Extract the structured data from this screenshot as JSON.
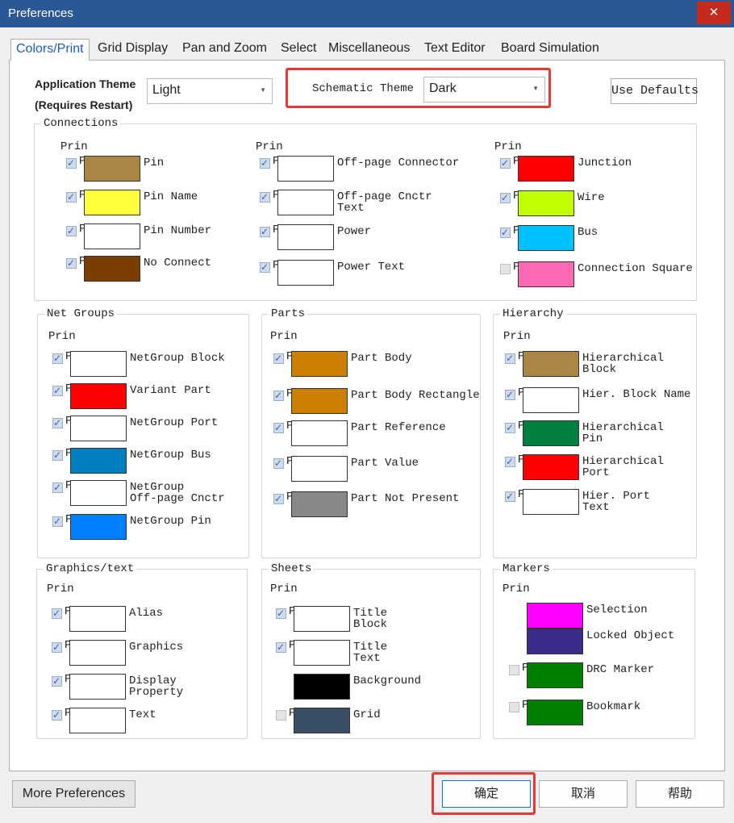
{
  "window": {
    "title": "Preferences",
    "close": "✕"
  },
  "tabs": [
    "Colors/Print",
    "Grid Display",
    "Pan and Zoom",
    "Select",
    "Miscellaneous",
    "Text Editor",
    "Board Simulation"
  ],
  "app_theme": {
    "label_line1": "Application Theme",
    "label_line2": "(Requires Restart)",
    "value": "Light"
  },
  "schematic_theme": {
    "label": "Schematic Theme",
    "value": "Dark"
  },
  "use_defaults": "Use Defaults",
  "print_header": "Prin",
  "check_cut": "P",
  "groups": {
    "connections": {
      "title": "Connections",
      "columns": [
        [
          {
            "label": [
              "Pin"
            ],
            "color": "#aa8544",
            "checked": true
          },
          {
            "label": [
              "Pin Name"
            ],
            "color": "#ffff3c",
            "checked": true
          },
          {
            "label": [
              "Pin Number"
            ],
            "color": "#ffffff",
            "checked": true
          },
          {
            "label": [
              "No Connect"
            ],
            "color": "#7b3d00",
            "checked": true
          }
        ],
        [
          {
            "label": [
              "Off-page Connector"
            ],
            "color": "#ffffff",
            "checked": true
          },
          {
            "label": [
              "Off-page Cnctr",
              "Text"
            ],
            "color": "#ffffff",
            "checked": true
          },
          {
            "label": [
              "Power"
            ],
            "color": "#ffffff",
            "checked": true
          },
          {
            "label": [
              "Power Text"
            ],
            "color": "#ffffff",
            "checked": true
          }
        ],
        [
          {
            "label": [
              "Junction"
            ],
            "color": "#ff0000",
            "checked": true
          },
          {
            "label": [
              "Wire"
            ],
            "color": "#bfff00",
            "checked": true
          },
          {
            "label": [
              "Bus"
            ],
            "color": "#00bfff",
            "checked": true
          },
          {
            "label": [
              "Connection Square"
            ],
            "color": "#ff69b4",
            "checked": false
          }
        ]
      ]
    },
    "net_groups": {
      "title": "Net Groups",
      "rows": [
        {
          "label": [
            "NetGroup Block"
          ],
          "color": "#ffffff",
          "checked": true
        },
        {
          "label": [
            "Variant Part"
          ],
          "color": "#ff0000",
          "checked": true
        },
        {
          "label": [
            "NetGroup Port"
          ],
          "color": "#ffffff",
          "checked": true
        },
        {
          "label": [
            "NetGroup Bus"
          ],
          "color": "#007fc0",
          "checked": true
        },
        {
          "label": [
            "NetGroup",
            "Off-page Cnctr"
          ],
          "color": "#ffffff",
          "checked": true
        },
        {
          "label": [
            "NetGroup Pin"
          ],
          "color": "#007fff",
          "checked": true
        }
      ]
    },
    "parts": {
      "title": "Parts",
      "rows": [
        {
          "label": [
            "Part Body"
          ],
          "color": "#cc7f00",
          "checked": true
        },
        {
          "label": [
            "Part Body Rectangle"
          ],
          "color": "#cc7f00",
          "checked": true
        },
        {
          "label": [
            "Part Reference"
          ],
          "color": "#ffffff",
          "checked": true
        },
        {
          "label": [
            "Part Value"
          ],
          "color": "#ffffff",
          "checked": true
        },
        {
          "label": [
            "Part Not Present"
          ],
          "color": "#888888",
          "checked": true
        }
      ]
    },
    "hierarchy": {
      "title": "Hierarchy",
      "rows": [
        {
          "label": [
            "Hierarchical",
            "Block"
          ],
          "color": "#aa8544",
          "checked": true
        },
        {
          "label": [
            "Hier. Block Name"
          ],
          "color": "#ffffff",
          "checked": true
        },
        {
          "label": [
            "Hierarchical",
            "Pin"
          ],
          "color": "#007f40",
          "checked": true
        },
        {
          "label": [
            "Hierarchical",
            "Port"
          ],
          "color": "#ff0000",
          "checked": true
        },
        {
          "label": [
            "Hier. Port",
            "Text"
          ],
          "color": "#ffffff",
          "checked": true
        }
      ]
    },
    "graphics": {
      "title": "Graphics/text",
      "rows": [
        {
          "label": [
            "Alias"
          ],
          "color": "#ffffff",
          "checked": true
        },
        {
          "label": [
            "Graphics"
          ],
          "color": "#ffffff",
          "checked": true
        },
        {
          "label": [
            "Display",
            "Property"
          ],
          "color": "#ffffff",
          "checked": true
        },
        {
          "label": [
            "Text"
          ],
          "color": "#ffffff",
          "checked": true
        }
      ]
    },
    "sheets": {
      "title": "Sheets",
      "rows": [
        {
          "label": [
            "Title",
            "Block"
          ],
          "color": "#ffffff",
          "checked": true,
          "has_check": true
        },
        {
          "label": [
            "Title",
            "Text"
          ],
          "color": "#ffffff",
          "checked": true,
          "has_check": true
        },
        {
          "label": [
            "Background"
          ],
          "color": "#000000",
          "checked": false,
          "has_check": false
        },
        {
          "label": [
            "Grid"
          ],
          "color": "#3a4f63",
          "checked": false,
          "has_check": true
        }
      ]
    },
    "markers": {
      "title": "Markers",
      "rows": [
        {
          "label": [
            "Selection"
          ],
          "color": "#ff00ff",
          "checked": false,
          "has_check": false
        },
        {
          "label": [
            "Locked Object"
          ],
          "color": "#3a2b8a",
          "checked": false,
          "has_check": false
        },
        {
          "label": [
            "DRC Marker"
          ],
          "color": "#007f00",
          "checked": false,
          "has_check": true
        },
        {
          "label": [
            "Bookmark"
          ],
          "color": "#007f00",
          "checked": false,
          "has_check": true
        }
      ]
    }
  },
  "buttons": {
    "more": "More Preferences",
    "ok": "确定",
    "cancel": "取消",
    "help": "帮助"
  },
  "highlight_color": "#e53935"
}
